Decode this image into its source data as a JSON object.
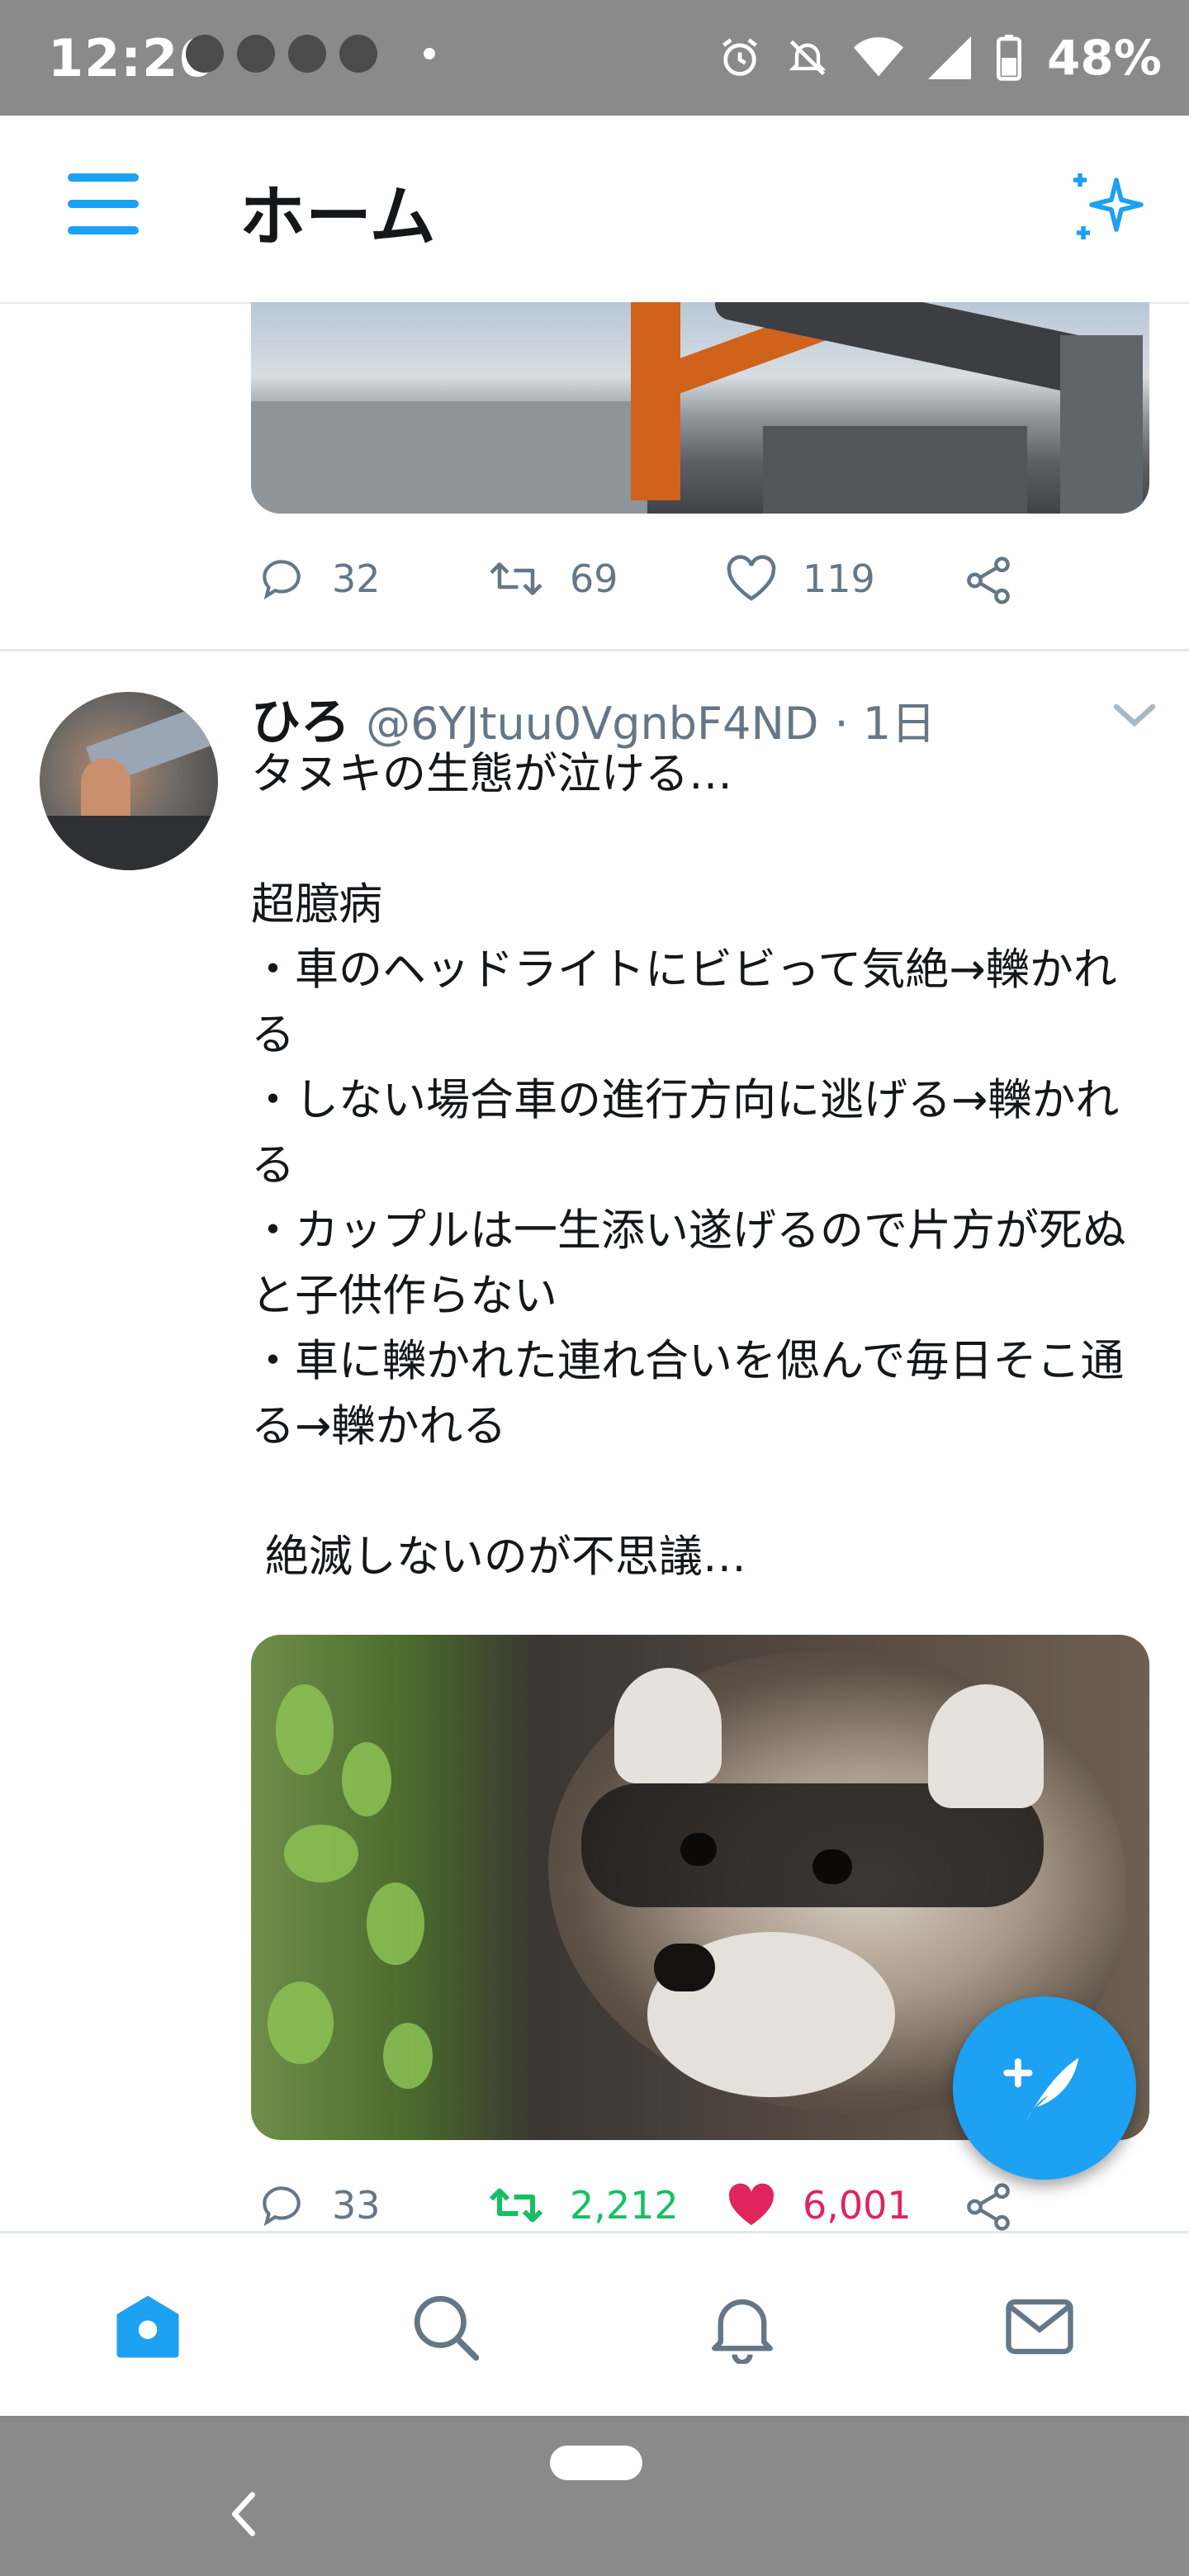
{
  "status_bar": {
    "time": "12:26",
    "battery": "48%"
  },
  "header": {
    "title": "ホーム"
  },
  "previous_tweet": {
    "replies": "32",
    "retweets": "69",
    "likes": "119"
  },
  "tweet": {
    "name": "ひろ",
    "handle": "@6YJtuu0VgnbF4ND",
    "time": "· 1日",
    "text": "タヌキの生態が泣ける…\n\n超臆病\n・車のヘッドライトにビビって気絶→轢かれる\n・しない場合車の進行方向に逃げる→轢かれる\n・カップルは一生添い遂げるので片方が死ぬと子供作らない\n・車に轢かれた連れ合いを偲んで毎日そこ通る→轢かれる\n\n 絶滅しないのが不思議…",
    "replies": "33",
    "retweets": "2,212",
    "likes": "6,001"
  },
  "colors": {
    "accent": "#1da1f2",
    "retweet_active": "#17bf63",
    "like_active": "#e0245e",
    "muted": "#657786"
  },
  "icons": {
    "nav_home": "home-icon",
    "nav_search": "search-icon",
    "nav_notifications": "bell-icon",
    "nav_messages": "mail-icon",
    "compose": "compose-icon",
    "sparkle": "sparkle-icon"
  }
}
